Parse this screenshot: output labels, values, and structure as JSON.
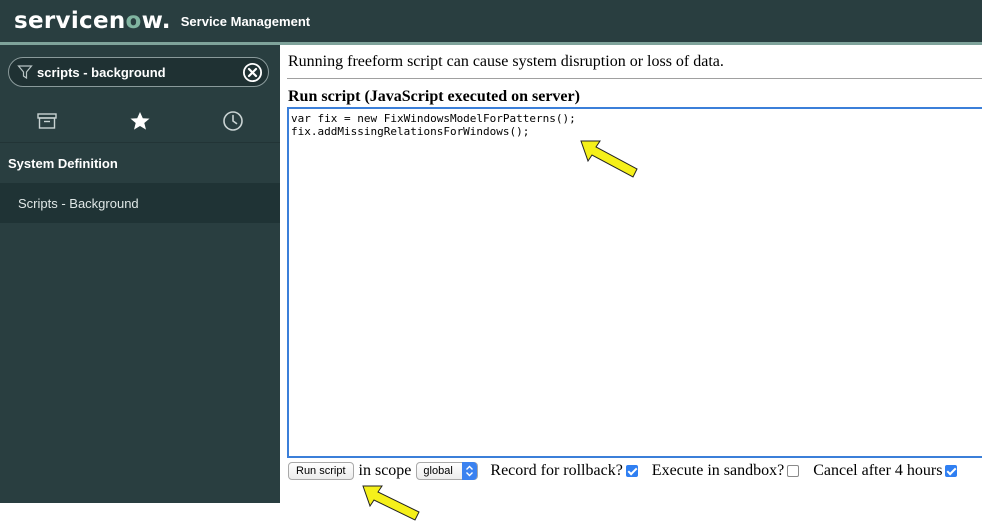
{
  "header": {
    "logo_text": "servicenow",
    "logo_prefix": "servicen",
    "logo_mark": "o",
    "logo_suffix": "w",
    "logo_tm": ".",
    "product": "Service Management"
  },
  "sidebar": {
    "filter_value": "scripts - background",
    "tabs": [
      {
        "icon": "archive-icon"
      },
      {
        "icon": "star-icon"
      },
      {
        "icon": "clock-icon"
      }
    ],
    "section": "System Definition",
    "module": "Scripts - Background"
  },
  "main": {
    "warning": "Running freeform script can cause system disruption or loss of data.",
    "heading": "Run script (JavaScript executed on server)",
    "script": "var fix = new FixWindowsModelForPatterns();\nfix.addMissingRelationsForWindows();"
  },
  "controls": {
    "run_button": "Run script",
    "in_scope": "in scope",
    "scope_value": "global",
    "rollback_label": "Record for rollback?",
    "rollback_checked": true,
    "sandbox_label": "Execute in sandbox?",
    "sandbox_checked": false,
    "cancel_label": "Cancel after 4 hours",
    "cancel_checked": true
  },
  "colors": {
    "header_bg": "#293e40",
    "accent": "#81b5a1",
    "focus_blue": "#3b7fd9",
    "annotation_arrow": "#f5f01a"
  }
}
